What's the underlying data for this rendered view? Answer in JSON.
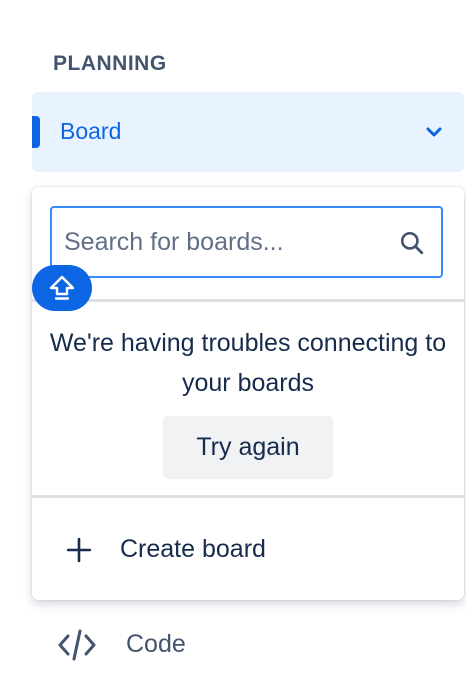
{
  "sidebar": {
    "section_heading": "PLANNING",
    "board_item": {
      "label": "Board",
      "icon": "chevron-down-icon",
      "expanded": true
    },
    "code_item": {
      "label": "Code",
      "icon": "code-icon"
    }
  },
  "dropdown": {
    "search": {
      "placeholder": "Search for boards...",
      "value": "",
      "icon": "search-icon"
    },
    "error": {
      "message": "We're having troubles connecting to your boards",
      "retry_label": "Try again"
    },
    "create": {
      "label": "Create board",
      "icon": "plus-icon"
    }
  },
  "collapse_badge": {
    "icon": "arrow-up-icon"
  },
  "colors": {
    "accent": "#0c66e4",
    "selected_bg": "#e9f2ff",
    "focus_border": "#388bff",
    "text": "#172b4d",
    "subtle_text": "#44546f",
    "button_bg": "#f1f2f4"
  }
}
